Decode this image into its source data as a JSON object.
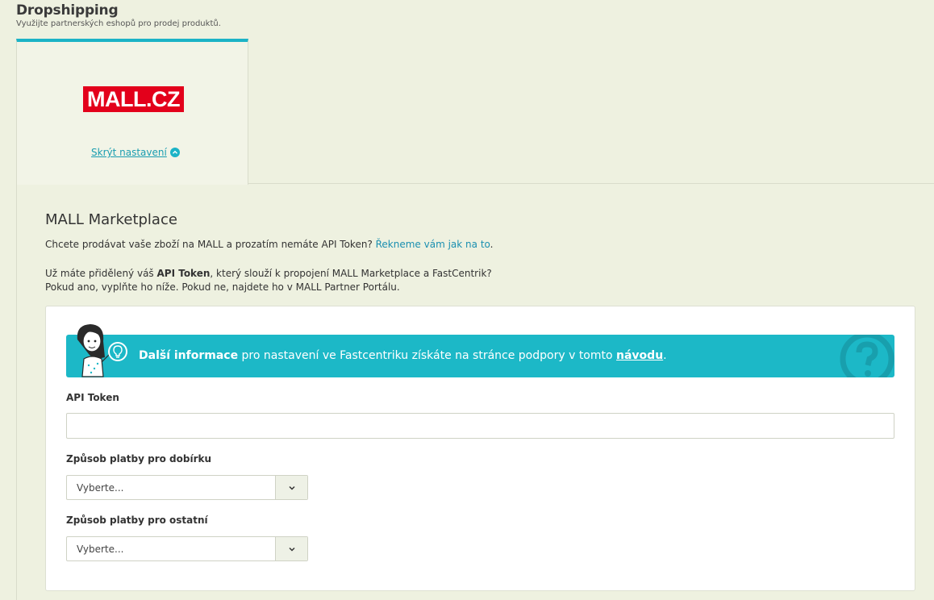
{
  "header": {
    "title": "Dropshipping",
    "subtitle": "Využijte partnerských eshopů pro prodej produktů."
  },
  "tab": {
    "logo_text": "MALL.CZ",
    "toggle_label": "Skrýt nastavení"
  },
  "section": {
    "title": "MALL Marketplace",
    "intro_text": "Chcete prodávat vaše zboží na MALL a prozatím nemáte API Token? ",
    "intro_link": "Řekneme vám jak na to",
    "intro_end": ".",
    "p2_start": "Už máte přidělený váš ",
    "p2_bold": "API Token",
    "p2_rest": ", který slouží k propojení MALL Marketplace a FastCentrik?",
    "p2_line2": "Pokud ano, vyplňte ho níže. Pokud ne, najdete ho v MALL Partner Portálu."
  },
  "banner": {
    "bold": "Další informace",
    "text": " pro nastavení ve Fastcentriku získáte na stránce podpory v tomto ",
    "link": "návodu",
    "end": "."
  },
  "form": {
    "api_token_label": "API Token",
    "api_token_value": "",
    "cod_label": "Způsob platby pro dobírku",
    "cod_value": "Vyberte...",
    "other_label": "Způsob platby pro ostatní",
    "other_value": "Vyberte..."
  },
  "colors": {
    "accent": "#1cb8c7",
    "brand_mall": "#e3001b",
    "background": "#eef1e0"
  }
}
